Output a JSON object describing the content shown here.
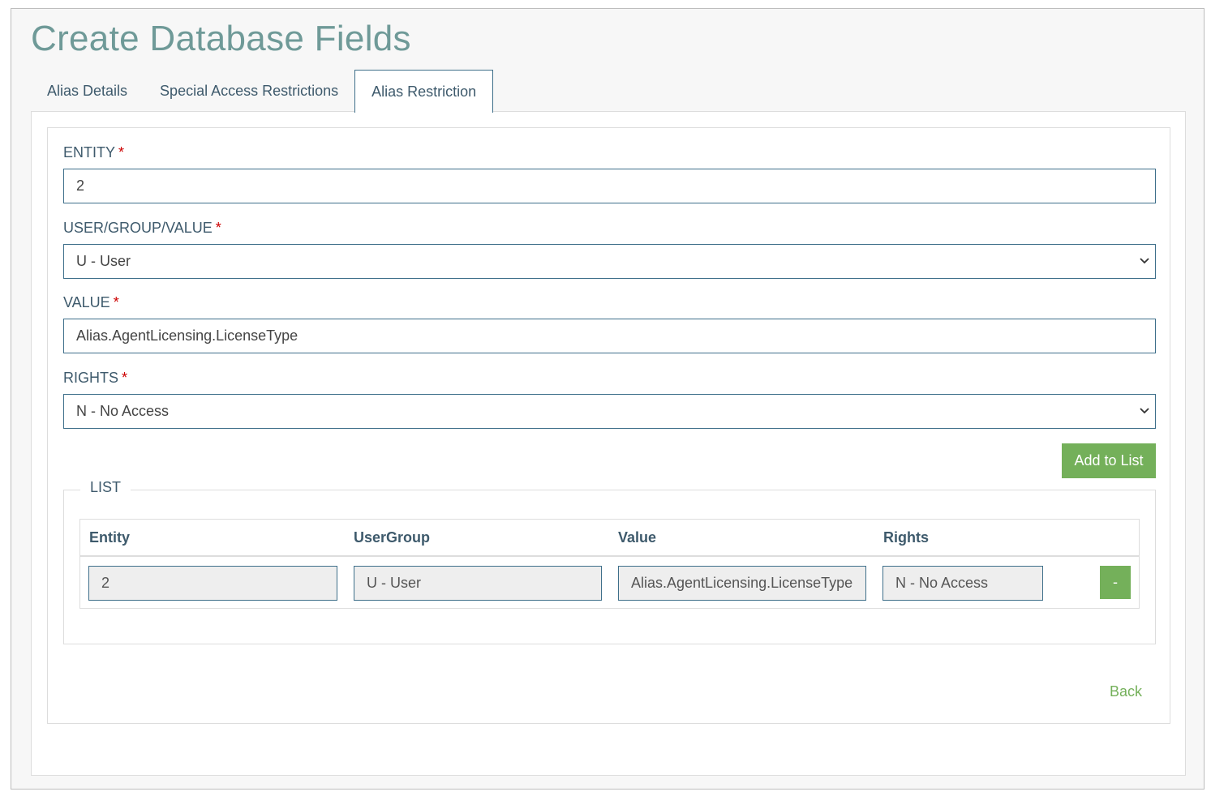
{
  "page": {
    "title": "Create Database Fields"
  },
  "tabs": [
    {
      "label": "Alias Details",
      "active": false
    },
    {
      "label": "Special Access Restrictions",
      "active": false
    },
    {
      "label": "Alias Restriction",
      "active": true
    }
  ],
  "form": {
    "required_marker": "*",
    "entity": {
      "label": "ENTITY",
      "value": "2"
    },
    "user_group_value": {
      "label": "USER/GROUP/VALUE",
      "value": "U - User"
    },
    "value": {
      "label": "VALUE",
      "value": "Alias.AgentLicensing.LicenseType"
    },
    "rights": {
      "label": "RIGHTS",
      "value": "N - No Access"
    },
    "add_button": "Add to List"
  },
  "list": {
    "legend": "LIST",
    "columns": [
      "Entity",
      "UserGroup",
      "Value",
      "Rights"
    ],
    "rows": [
      {
        "entity": "2",
        "usergroup": "U - User",
        "value": "Alias.AgentLicensing.LicenseType",
        "rights": "N - No Access",
        "remove_label": "-"
      }
    ]
  },
  "back_link": "Back",
  "colors": {
    "accent_green": "#74b05a",
    "title_teal": "#6f9a98",
    "border_blue": "#3e6f8a",
    "required_red": "#cc0000"
  }
}
